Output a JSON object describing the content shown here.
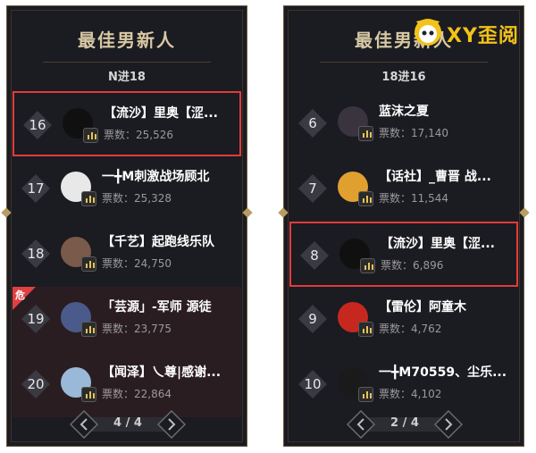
{
  "left_panel": {
    "title": "最佳男新人",
    "subtitle": "N进18",
    "pager": "4 / 4",
    "rows": [
      {
        "rank": "16",
        "name": "【流沙】里奥【涩...",
        "votes_label": "票数：",
        "votes": "25,526",
        "highlight": true,
        "danger": false,
        "avatar_color": "#101010"
      },
      {
        "rank": "17",
        "name": "一╋M刺激战场顾北",
        "votes_label": "票数：",
        "votes": "25,328",
        "highlight": false,
        "danger": false,
        "avatar_color": "#e8e8e8"
      },
      {
        "rank": "18",
        "name": "【千艺】起跑线乐队",
        "votes_label": "票数：",
        "votes": "24,750",
        "highlight": false,
        "danger": false,
        "avatar_color": "#7a5a4a"
      },
      {
        "rank": "19",
        "name": "「芸源」-军师 源徒",
        "votes_label": "票数：",
        "votes": "23,775",
        "highlight": false,
        "danger": true,
        "avatar_color": "#4a5a8a"
      },
      {
        "rank": "20",
        "name": "【闻泽】乀尊|感谢...",
        "votes_label": "票数：",
        "votes": "22,864",
        "highlight": false,
        "danger": true,
        "avatar_color": "#9ab8d8"
      }
    ],
    "danger_label": "危"
  },
  "right_panel": {
    "title": "最佳男新人",
    "subtitle": "18进16",
    "pager": "2 / 4",
    "rows": [
      {
        "rank": "6",
        "name": "蓝沫之夏",
        "votes_label": "票数：",
        "votes": "17,140",
        "highlight": false,
        "danger": false,
        "avatar_color": "#3a3340"
      },
      {
        "rank": "7",
        "name": "【话社】_曹晋 战...",
        "votes_label": "票数：",
        "votes": "11,544",
        "highlight": false,
        "danger": false,
        "avatar_color": "#e0a030"
      },
      {
        "rank": "8",
        "name": "【流沙】里奥【涩...",
        "votes_label": "票数：",
        "votes": "6,896",
        "highlight": true,
        "danger": false,
        "avatar_color": "#101010"
      },
      {
        "rank": "9",
        "name": "【雷伦】阿童木",
        "votes_label": "票数：",
        "votes": "4,762",
        "highlight": false,
        "danger": false,
        "avatar_color": "#c62820"
      },
      {
        "rank": "10",
        "name": "一╋M70559、尘乐...",
        "votes_label": "票数：",
        "votes": "4,102",
        "highlight": false,
        "danger": false,
        "avatar_color": "#1a1a1a"
      }
    ]
  },
  "logo": {
    "text": "XY歪阅"
  },
  "colors": {
    "panel_bg": "#1b1b22",
    "gold": "#d8c9a4",
    "highlight": "#e23b3b",
    "danger": "#e04040"
  },
  "icons": {
    "rank_badge": "diamond-icon",
    "vote": "bar-chart-icon",
    "prev": "chevron-left-icon",
    "next": "chevron-right-icon"
  }
}
